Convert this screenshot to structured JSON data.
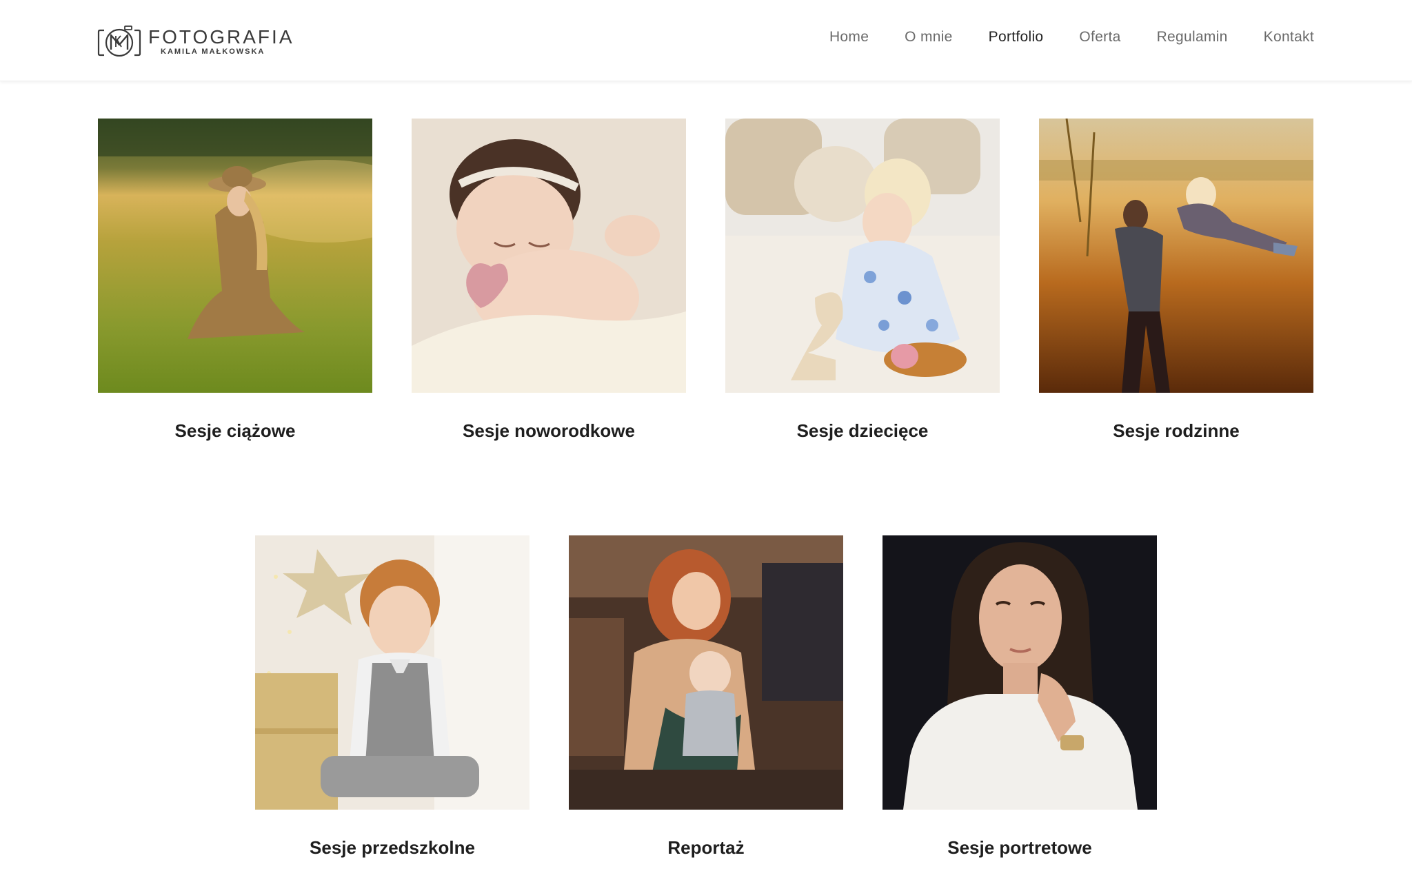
{
  "header": {
    "logo": {
      "title": "FOTOGRAFIA",
      "subtitle": "KAMILA MAŁKOWSKA",
      "icon": "camera-monogram-icon"
    },
    "nav": [
      {
        "label": "Home",
        "active": false
      },
      {
        "label": "O mnie",
        "active": false
      },
      {
        "label": "Portfolio",
        "active": true
      },
      {
        "label": "Oferta",
        "active": false
      },
      {
        "label": "Regulamin",
        "active": false
      },
      {
        "label": "Kontakt",
        "active": false
      }
    ]
  },
  "gallery": {
    "items": [
      {
        "caption": "Sesje ciążowe",
        "image": "maternity-photo"
      },
      {
        "caption": "Sesje noworodkowe",
        "image": "newborn-photo"
      },
      {
        "caption": "Sesje dziecięce",
        "image": "child-photo"
      },
      {
        "caption": "Sesje rodzinne",
        "image": "family-photo"
      },
      {
        "caption": "Sesje przedszkolne",
        "image": "preschool-photo"
      },
      {
        "caption": "Reportaż",
        "image": "reportage-photo"
      },
      {
        "caption": "Sesje portretowe",
        "image": "portrait-photo"
      }
    ]
  },
  "colors": {
    "text_dark": "#1e1e1e",
    "nav_text": "#6a6a6a",
    "nav_active": "#222222",
    "background": "#ffffff"
  }
}
